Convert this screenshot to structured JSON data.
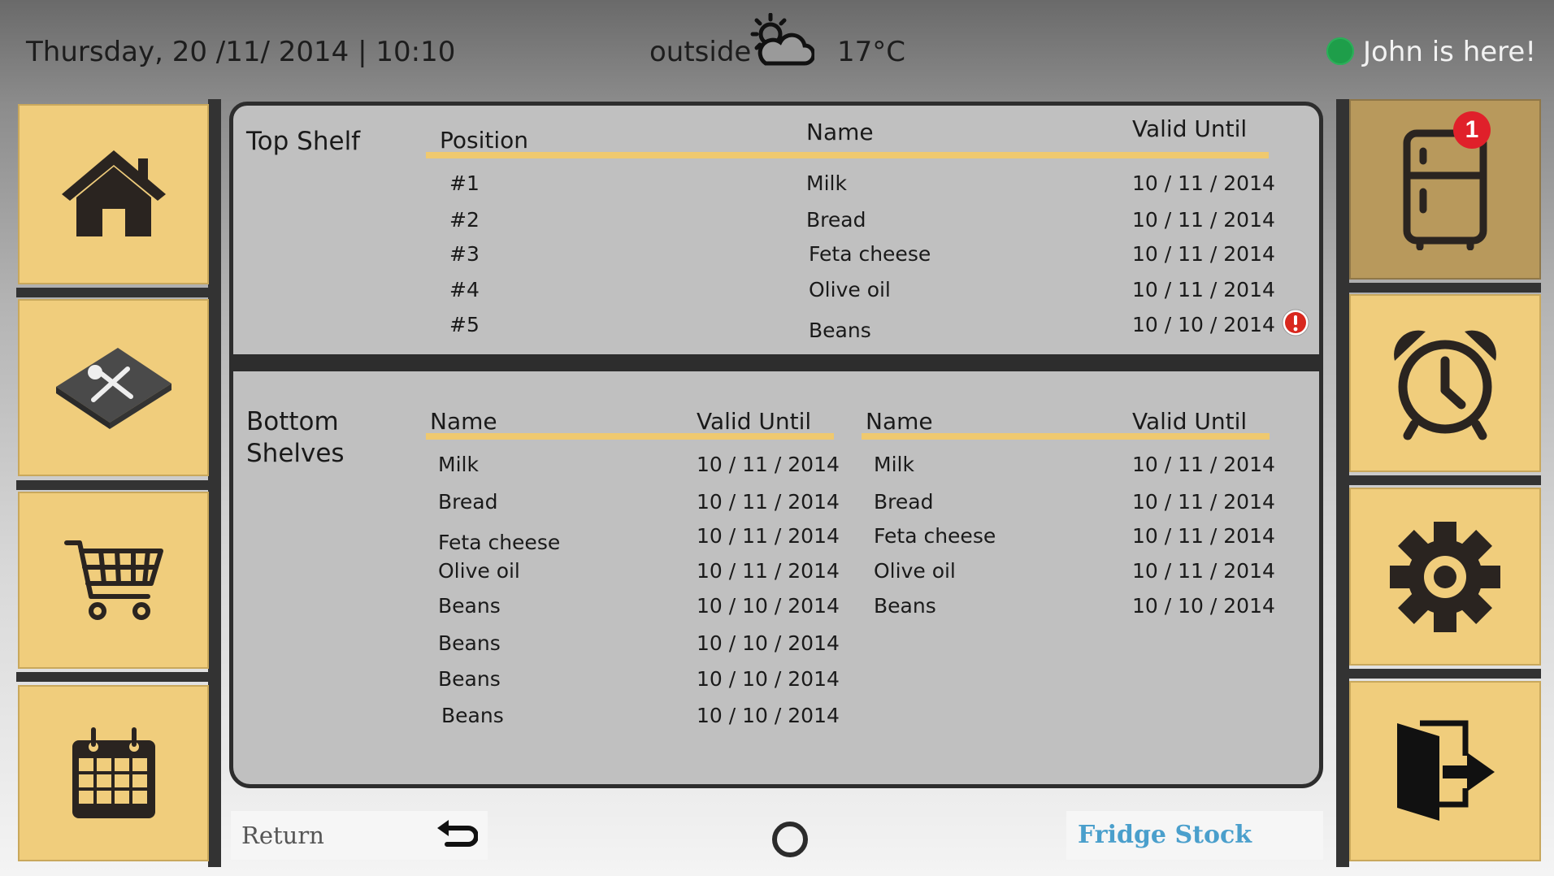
{
  "header": {
    "datetime": "Thursday, 20 /11/ 2014 | 10:10",
    "outside_label": "outside",
    "weather_icon": "partly-cloudy-icon",
    "temperature": "17°C",
    "user_status": "John is here!",
    "presence_color": "#1e9e4a"
  },
  "left_nav": [
    {
      "icon": "home-icon"
    },
    {
      "icon": "recipe-book-icon"
    },
    {
      "icon": "shopping-cart-icon"
    },
    {
      "icon": "calendar-icon"
    }
  ],
  "right_nav": [
    {
      "icon": "fridge-icon",
      "badge": "1",
      "active": true
    },
    {
      "icon": "alarm-clock-icon"
    },
    {
      "icon": "gear-icon"
    },
    {
      "icon": "exit-door-icon"
    }
  ],
  "top_shelf": {
    "title": "Top Shelf",
    "headers": {
      "position": "Position",
      "name": "Name",
      "valid_until": "Valid Until"
    },
    "rows": [
      {
        "position": "#1",
        "name": "Milk",
        "valid_until": "10 / 11 / 2014"
      },
      {
        "position": "#2",
        "name": "Bread",
        "valid_until": "10 / 11 / 2014"
      },
      {
        "position": "#3",
        "name": "Feta cheese",
        "valid_until": "10 / 11 / 2014"
      },
      {
        "position": "#4",
        "name": "Olive oil",
        "valid_until": "10 / 11 / 2014"
      },
      {
        "position": "#5",
        "name": "Beans",
        "valid_until": "10 / 10 / 2014",
        "warning": true
      }
    ]
  },
  "bottom_shelves": {
    "title_line1": "Bottom",
    "title_line2": "Shelves",
    "left_table": {
      "headers": {
        "name": "Name",
        "valid_until": "Valid Until"
      },
      "rows": [
        {
          "name": "Milk",
          "valid_until": "10 / 11 / 2014"
        },
        {
          "name": "Bread",
          "valid_until": "10 / 11 / 2014"
        },
        {
          "name": "Feta cheese",
          "valid_until": "10 / 11 / 2014"
        },
        {
          "name": "Olive oil",
          "valid_until": "10 / 11 / 2014"
        },
        {
          "name": "Beans",
          "valid_until": "10 / 10 / 2014"
        },
        {
          "name": "Beans",
          "valid_until": "10 / 10 / 2014"
        },
        {
          "name": "Beans",
          "valid_until": "10 / 10 / 2014"
        },
        {
          "name": "Beans",
          "valid_until": "10 / 10 / 2014"
        }
      ]
    },
    "right_table": {
      "headers": {
        "name": "Name",
        "valid_until": "Valid Until"
      },
      "rows": [
        {
          "name": "Milk",
          "valid_until": "10 / 11 / 2014"
        },
        {
          "name": "Bread",
          "valid_until": "10 / 11 / 2014"
        },
        {
          "name": "Feta cheese",
          "valid_until": "10 / 11 / 2014"
        },
        {
          "name": "Olive oil",
          "valid_until": "10 / 11 / 2014"
        },
        {
          "name": "Beans",
          "valid_until": "10 / 10 / 2014"
        }
      ]
    }
  },
  "footer": {
    "return_label": "Return",
    "return_icon": "return-arrow-icon",
    "home_icon": "circle-home-icon",
    "screen_title": "Fridge Stock"
  },
  "colors": {
    "tile": "#f0cd7c",
    "tile_active": "#b8995c",
    "header_rule": "#efc96f",
    "panel": "#c0c0c0",
    "accent_link": "#4a9fcc",
    "badge": "#e0202a"
  }
}
